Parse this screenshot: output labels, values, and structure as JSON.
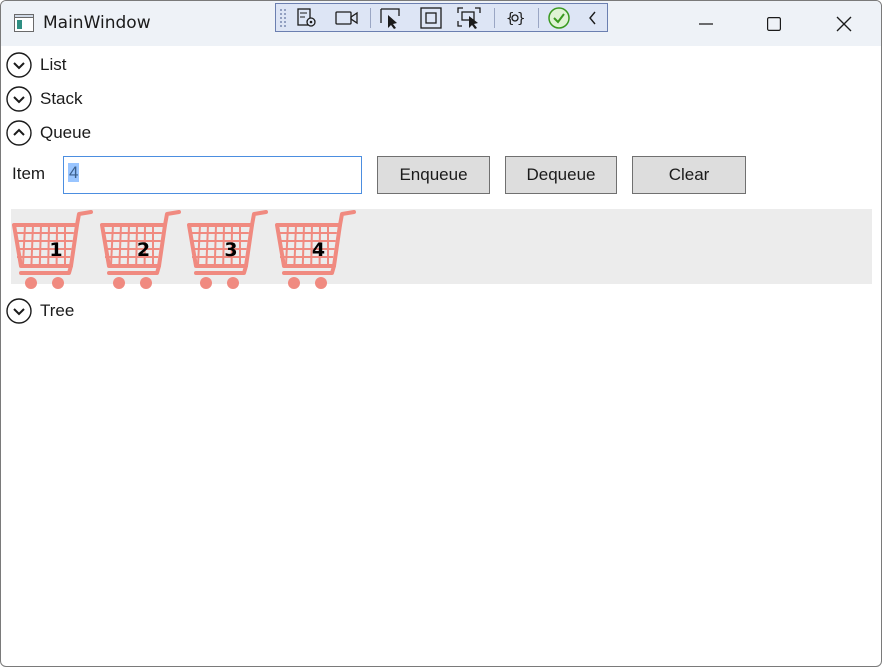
{
  "window": {
    "title": "MainWindow"
  },
  "devtools": {
    "icons": [
      "grip-icon",
      "live-visual-tree-icon",
      "record-icon",
      "select-element-icon",
      "display-layout-adorners-icon",
      "track-focus-icon",
      "binding-failures-icon",
      "hot-reload-status-icon",
      "collapse-toolbar-icon"
    ]
  },
  "sections": {
    "list": {
      "label": "List",
      "expanded": false
    },
    "stack": {
      "label": "Stack",
      "expanded": false
    },
    "queue": {
      "label": "Queue",
      "expanded": true
    },
    "tree": {
      "label": "Tree",
      "expanded": false
    }
  },
  "queue": {
    "item_label": "Item",
    "item_value": "4",
    "buttons": {
      "enqueue": "Enqueue",
      "dequeue": "Dequeue",
      "clear": "Clear"
    },
    "items": [
      "1",
      "2",
      "3",
      "4"
    ],
    "cart_color": "#f08a80"
  }
}
